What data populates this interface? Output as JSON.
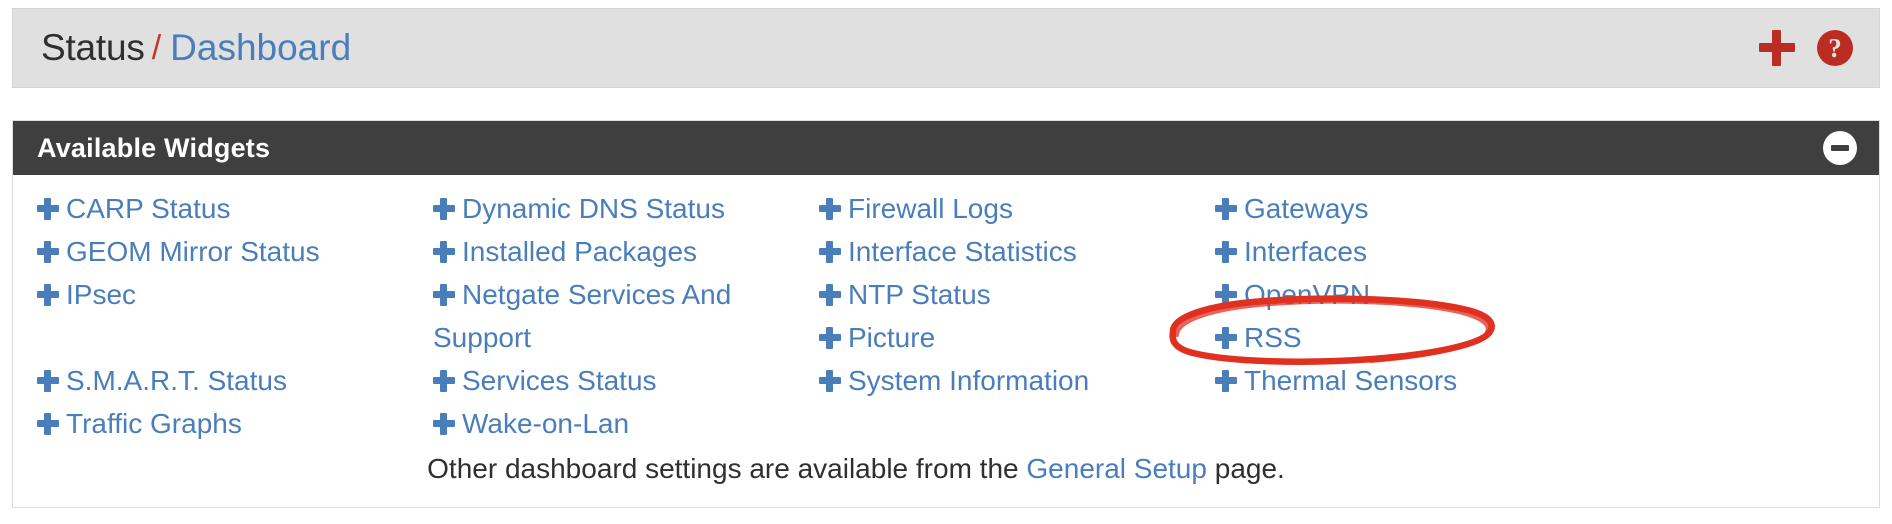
{
  "header": {
    "breadcrumb": {
      "root": "Status",
      "separator": "/",
      "current": "Dashboard"
    },
    "actions": {
      "add_widget_icon": "plus-icon",
      "help_icon": "help-circle-icon",
      "help_glyph": "?"
    },
    "accent_color": "#bb2d23",
    "link_color": "#4a7ebb",
    "background_color": "#e0e0e0"
  },
  "panel": {
    "title": "Available Widgets",
    "collapse_icon": "minus-circle-icon",
    "heading_background": "#3f3f3f",
    "columns": [
      {
        "items": [
          {
            "label": "CARP Status",
            "spacer_before": false
          },
          {
            "label": "GEOM Mirror Status",
            "spacer_before": false
          },
          {
            "label": "IPsec",
            "spacer_before": false
          },
          {
            "label": "S.M.A.R.T. Status",
            "spacer_before": true
          },
          {
            "label": "Traffic Graphs",
            "spacer_before": false
          }
        ]
      },
      {
        "items": [
          {
            "label": "Dynamic DNS Status",
            "spacer_before": false
          },
          {
            "label": "Installed Packages",
            "spacer_before": false
          },
          {
            "label": "Netgate Services And Support",
            "spacer_before": false
          },
          {
            "label": "Services Status",
            "spacer_before": false
          },
          {
            "label": "Wake-on-Lan",
            "spacer_before": false
          }
        ]
      },
      {
        "items": [
          {
            "label": "Firewall Logs",
            "spacer_before": false
          },
          {
            "label": "Interface Statistics",
            "spacer_before": false
          },
          {
            "label": "NTP Status",
            "spacer_before": false
          },
          {
            "label": "Picture",
            "spacer_before": false
          },
          {
            "label": "System Information",
            "spacer_before": false
          }
        ]
      },
      {
        "items": [
          {
            "label": "Gateways",
            "spacer_before": false
          },
          {
            "label": "Interfaces",
            "spacer_before": false
          },
          {
            "label": "OpenVPN",
            "spacer_before": false
          },
          {
            "label": "RSS",
            "spacer_before": false
          },
          {
            "label": "Thermal Sensors",
            "spacer_before": false
          }
        ]
      }
    ],
    "footer": {
      "text_before": "Other dashboard settings are available from the ",
      "link": "General Setup",
      "text_after": " page."
    }
  },
  "annotation": {
    "type": "hand-drawn-ellipse",
    "color": "#e03020",
    "target_label": "OpenVPN"
  }
}
